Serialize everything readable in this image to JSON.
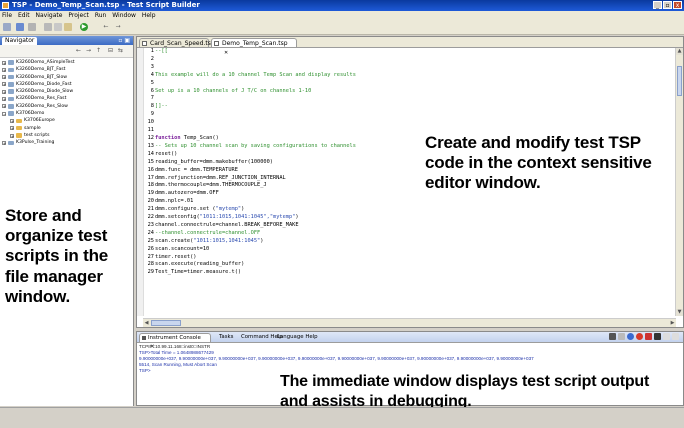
{
  "window": {
    "title": "TSP - Demo_Temp_Scan.tsp - Test Script Builder",
    "controls": [
      "_",
      "▫",
      "x"
    ]
  },
  "menu": [
    "File",
    "Edit",
    "Navigate",
    "Project",
    "Run",
    "Window",
    "Help"
  ],
  "navigator": {
    "tab_label": "Navigator",
    "items": [
      {
        "label": "K3260Demo_ASimpleTest",
        "indent": 0,
        "expanded": false
      },
      {
        "label": "K3260Demo_BJT_Fast",
        "indent": 0,
        "expanded": false
      },
      {
        "label": "K3260Demo_BJT_Slow",
        "indent": 0,
        "expanded": false
      },
      {
        "label": "K3260Demo_Diode_Fast",
        "indent": 0,
        "expanded": false
      },
      {
        "label": "K3260Demo_Diode_Slow",
        "indent": 0,
        "expanded": false
      },
      {
        "label": "K3260Demo_Res_Fast",
        "indent": 0,
        "expanded": false
      },
      {
        "label": "K3260Demo_Res_Slow",
        "indent": 0,
        "expanded": false
      },
      {
        "label": "K3706Demo",
        "indent": 0,
        "expanded": true
      },
      {
        "label": "K3706Europe",
        "indent": 1,
        "expanded": false
      },
      {
        "label": "sample",
        "indent": 1,
        "expanded": false
      },
      {
        "label": "test scripts",
        "indent": 1,
        "expanded": false
      },
      {
        "label": "K3Pulse_Training",
        "indent": 0,
        "expanded": false
      }
    ]
  },
  "editor": {
    "tabs": [
      {
        "label": "Card_Scan_Speed.tsp",
        "active": false
      },
      {
        "label": "Demo_Temp_Scan.tsp",
        "active": true
      }
    ],
    "lines": [
      {
        "n": "1",
        "text": "--[[",
        "cls": "c-cm"
      },
      {
        "n": "2",
        "text": "",
        "cls": ""
      },
      {
        "n": "3",
        "text": "",
        "cls": ""
      },
      {
        "n": "4",
        "text": "This example will do a 10 channel Temp Scan and display results",
        "cls": "c-cm"
      },
      {
        "n": "5",
        "text": "",
        "cls": ""
      },
      {
        "n": "6",
        "text": "Set up is a 10 channels of J T/C on channels 1-10",
        "cls": "c-cm"
      },
      {
        "n": "7",
        "text": "",
        "cls": ""
      },
      {
        "n": "8",
        "text": "]]--",
        "cls": "c-cm"
      },
      {
        "n": "9",
        "text": "",
        "cls": ""
      },
      {
        "n": "10",
        "text": "",
        "cls": ""
      },
      {
        "n": "11",
        "text": "",
        "cls": ""
      },
      {
        "n": "12",
        "kw": "function",
        "text": " Temp_Scan()",
        "cls": ""
      },
      {
        "n": "13",
        "text": "-- Sets up 10 channel scan by saving configurations to channels",
        "cls": "c-cm"
      },
      {
        "n": "14",
        "text": "reset()",
        "cls": ""
      },
      {
        "n": "15",
        "text": "reading_buffer=dmm.makebuffer(100000)",
        "cls": ""
      },
      {
        "n": "16",
        "text": "dmm.func = dmm.TEMPERATURE",
        "cls": ""
      },
      {
        "n": "17",
        "text": "dmm.refjunction=dmm.REF_JUNCTION_INTERNAL",
        "cls": ""
      },
      {
        "n": "18",
        "text": "dmm.thermocouple=dmm.THERMOCOUPLE_J",
        "cls": ""
      },
      {
        "n": "19",
        "text": "dmm.autozero=dmm.OFF",
        "cls": ""
      },
      {
        "n": "20",
        "text": "dmm.nplc=.01",
        "cls": ""
      },
      {
        "n": "21",
        "pre": "dmm.configure.set (",
        "str": "\"mytemp\"",
        "post": ")",
        "cls": ""
      },
      {
        "n": "22",
        "pre": "dmm.setconfig(",
        "str": "\"1011:1015,1041:1045\",\"mytemp\"",
        "post": ")",
        "cls": ""
      },
      {
        "n": "23",
        "text": "channel.connectrule=channel.BREAK_BEFORE_MAKE",
        "cls": ""
      },
      {
        "n": "24",
        "text": "--channel.connectrule=channel.OFF",
        "cls": "c-cm"
      },
      {
        "n": "25",
        "pre": "scan.create(",
        "str": "\"1011:1015,1041:1045\"",
        "post": ")",
        "cls": ""
      },
      {
        "n": "26",
        "text": "scan.scancount=10",
        "cls": ""
      },
      {
        "n": "27",
        "text": "timer.reset()",
        "cls": ""
      },
      {
        "n": "28",
        "text": "scan.execute(reading_buffer)",
        "cls": ""
      },
      {
        "n": "29",
        "text": "Test_Time=timer.measure.t()",
        "cls": ""
      }
    ]
  },
  "console": {
    "tabs": [
      "Instrument Console",
      "Tasks",
      "Command Help",
      "Language Help"
    ],
    "output": [
      {
        "text": "TCPIP::10.99.11.168::inst0::INSTR",
        "cls": ""
      },
      {
        "text": "TSP>Total Time = 1.0648988677429",
        "cls": "blue"
      },
      {
        "text": "9.90000000e+037, 9.90000000e+037, 9.90000000e+037, 9.90000000e+037, 9.90000000e+037, 9.90000000e+037, 9.90000000e+037, 9.90000000e+037, 9.90000000e+037, 9.90000000e+037",
        "cls": "blue"
      },
      {
        "text": "5514, Scan Running, Must Abort Scan",
        "cls": "blue"
      },
      {
        "text": "TSP>",
        "cls": "blue"
      }
    ]
  },
  "annotations": {
    "store": "Store and organize test scripts in the file manager window.",
    "create": "Create and modify test TSP code in the context sensitive editor window.",
    "immediate": "The immediate window displays test script output and assists in debugging."
  }
}
